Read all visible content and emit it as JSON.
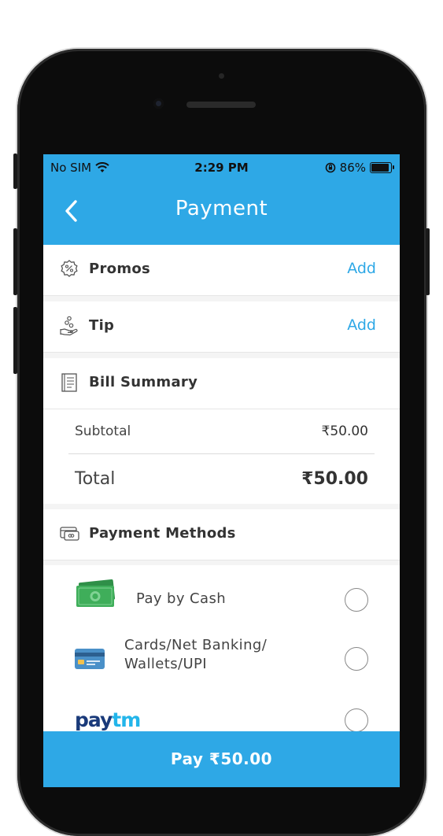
{
  "status_bar": {
    "carrier": "No SIM",
    "time": "2:29 PM",
    "battery_percent": "86%",
    "battery_level": 0.86
  },
  "header": {
    "title": "Payment"
  },
  "promos": {
    "label": "Promos",
    "action": "Add"
  },
  "tip": {
    "label": "Tip",
    "action": "Add"
  },
  "bill_summary": {
    "label": "Bill Summary",
    "subtotal_label": "Subtotal",
    "subtotal_value": "₹50.00",
    "total_label": "Total",
    "total_value": "₹50.00"
  },
  "payment_methods": {
    "label": "Payment Methods",
    "options": [
      {
        "label": "Pay by Cash",
        "icon": "cash-icon"
      },
      {
        "label_line1": "Cards/Net Banking/",
        "label_line2": "Wallets/UPI",
        "icon": "card-icon"
      },
      {
        "label": "paytm",
        "icon": "paytm-logo"
      }
    ]
  },
  "pay_button": {
    "label": "Pay ₹50.00"
  },
  "colors": {
    "accent": "#2ea8e6",
    "paytm_dark": "#1a3a7a",
    "paytm_light": "#22b5ea",
    "cash_green": "#3fae5a"
  }
}
